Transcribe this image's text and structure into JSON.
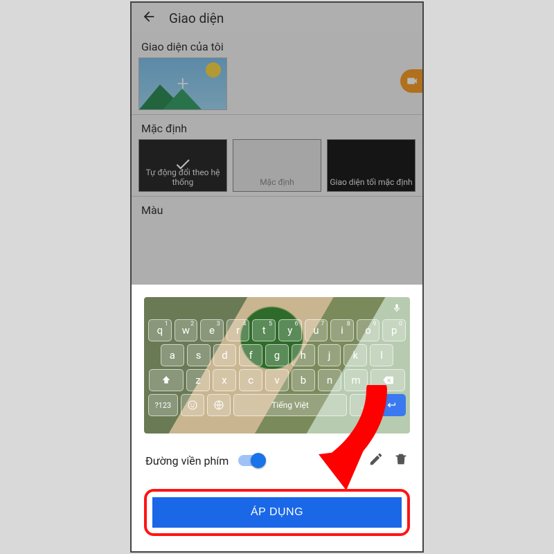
{
  "header": {
    "title": "Giao diện"
  },
  "sections": {
    "mine": "Giao diện của tôi",
    "default": "Mặc định",
    "color": "Màu"
  },
  "default_options": {
    "auto": "Tự động đổi theo hệ thống",
    "default": "Mặc định",
    "dark": "Giao diện tối mặc định"
  },
  "keyboard": {
    "row1": [
      {
        "l": "q",
        "n": "1"
      },
      {
        "l": "w",
        "n": "2"
      },
      {
        "l": "e",
        "n": "3"
      },
      {
        "l": "r",
        "n": "4"
      },
      {
        "l": "t",
        "n": "5"
      },
      {
        "l": "y",
        "n": "6"
      },
      {
        "l": "u",
        "n": "7"
      },
      {
        "l": "i",
        "n": "8"
      },
      {
        "l": "o",
        "n": "9"
      },
      {
        "l": "p",
        "n": "0"
      }
    ],
    "row2": [
      "a",
      "s",
      "d",
      "f",
      "g",
      "h",
      "j",
      "k",
      "l"
    ],
    "row3": [
      "z",
      "x",
      "c",
      "v",
      "b",
      "n",
      "m"
    ],
    "symbols_label": "?123",
    "space_label": "Tiếng Việt"
  },
  "sheet": {
    "border_label": "Đường viền phím",
    "apply_label": "ÁP DỤNG"
  }
}
